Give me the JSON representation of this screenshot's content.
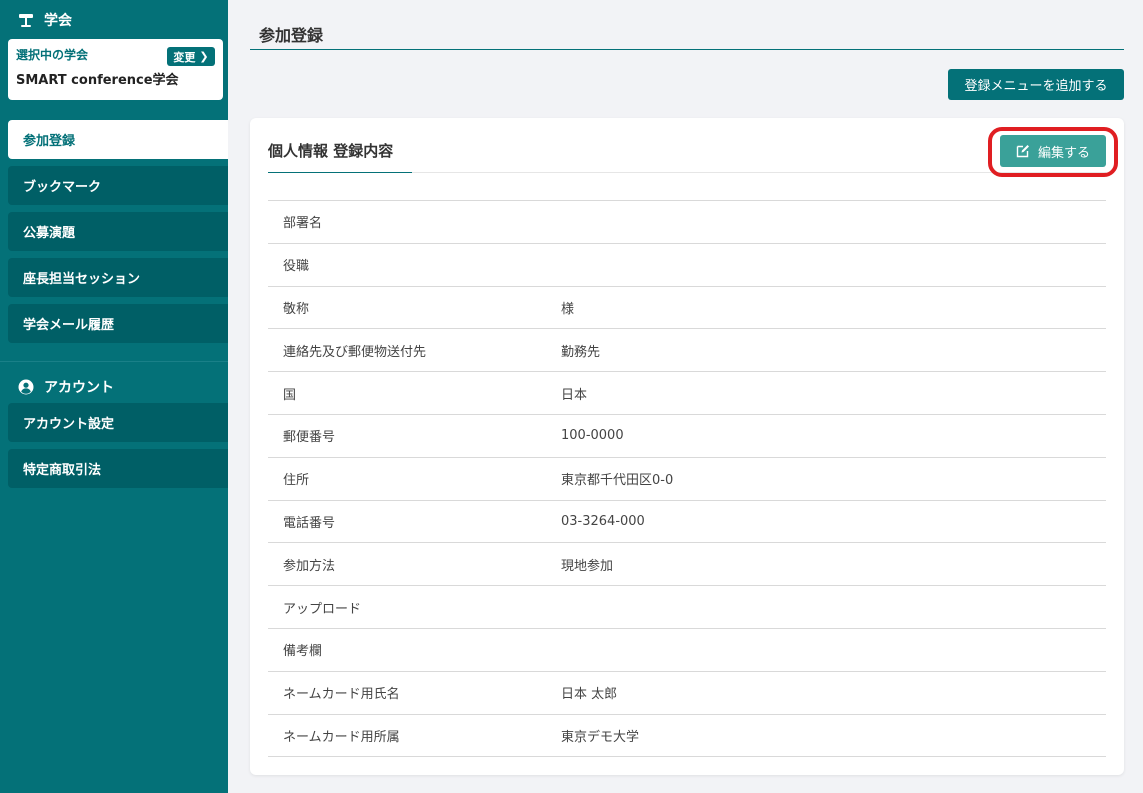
{
  "sidebar": {
    "conference_section": "学会",
    "selected_label": "選択中の学会",
    "conference_name": "SMART conference学会",
    "change_label": "変更",
    "items": [
      {
        "label": "参加登録"
      },
      {
        "label": "ブックマーク"
      },
      {
        "label": "公募演題"
      },
      {
        "label": "座長担当セッション"
      },
      {
        "label": "学会メール履歴"
      }
    ],
    "account_section": "アカウント",
    "account_items": [
      {
        "label": "アカウント設定"
      },
      {
        "label": "特定商取引法"
      }
    ]
  },
  "main": {
    "page_title": "参加登録",
    "add_menu_label": "登録メニューを追加する",
    "card_title": "個人情報 登録内容",
    "edit_label": "編集する",
    "rows": [
      {
        "key": "部署名",
        "value": ""
      },
      {
        "key": "役職",
        "value": ""
      },
      {
        "key": "敬称",
        "value": "様"
      },
      {
        "key": "連絡先及び郵便物送付先",
        "value": "勤務先"
      },
      {
        "key": "国",
        "value": "日本"
      },
      {
        "key": "郵便番号",
        "value": "100-0000"
      },
      {
        "key": "住所",
        "value": "東京都千代田区0-0"
      },
      {
        "key": "電話番号",
        "value": "03-3264-000"
      },
      {
        "key": "参加方法",
        "value": "現地参加"
      },
      {
        "key": "アップロード",
        "value": ""
      },
      {
        "key": "備考欄",
        "value": ""
      },
      {
        "key": "ネームカード用氏名",
        "value": "日本 太郎"
      },
      {
        "key": "ネームカード用所属",
        "value": "東京デモ大学"
      }
    ]
  },
  "colors": {
    "brand": "#047178",
    "edit_button": "#3aa199",
    "highlight": "#e01e22"
  }
}
